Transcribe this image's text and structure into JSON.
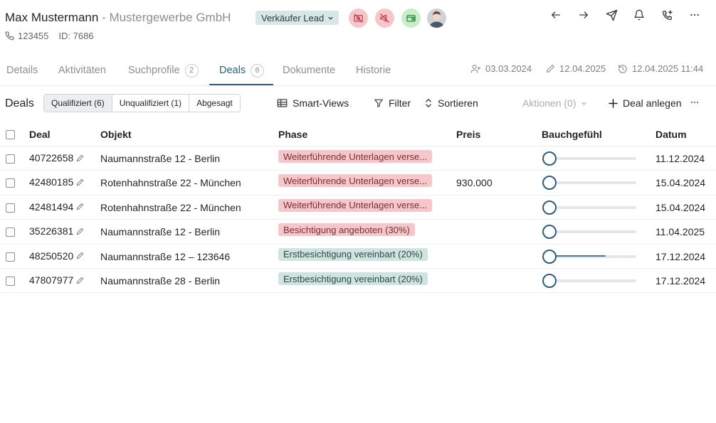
{
  "header": {
    "person_name": "Max Mustermann",
    "separator": " - ",
    "company": "Mustergewerbe GmbH",
    "phone": "123455",
    "id_text": "ID: 7686",
    "lead_badge": "Verkäufer Lead",
    "status_icons": [
      "no-camera-icon",
      "no-megaphone-icon",
      "wallet-icon"
    ],
    "avatar": "user-avatar",
    "top_icons": [
      "arrow-left-icon",
      "arrow-right-icon",
      "send-icon",
      "bell-icon",
      "phone-plus-icon",
      "more-icon"
    ]
  },
  "tabs": [
    {
      "label": "Details"
    },
    {
      "label": "Aktivitäten"
    },
    {
      "label": "Suchprofile",
      "count": "2"
    },
    {
      "label": "Deals",
      "count": "6",
      "active": true
    },
    {
      "label": "Dokumente"
    },
    {
      "label": "Historie"
    }
  ],
  "meta": {
    "created": "03.03.2024",
    "edited": "12.04.2025",
    "history": "12.04.2025 11:44"
  },
  "toolbar": {
    "title": "Deals",
    "filters": [
      "Qualifiziert (6)",
      "Unqualifiziert (1)",
      "Abgesagt"
    ],
    "smart_views": "Smart-Views",
    "filter": "Filter",
    "sort": "Sortieren",
    "actions": "Aktionen (0)",
    "add_deal": "Deal anlegen"
  },
  "table": {
    "columns": [
      "Deal",
      "Objekt",
      "Phase",
      "Preis",
      "Bauchgefühl",
      "Datum"
    ],
    "rows": [
      {
        "deal": "40722658",
        "objekt": "Naumannstraße 12 - Berlin",
        "phase": "Weiterführende Unterlagen verse...",
        "phase_color": "red",
        "preis": "",
        "gefuehl": 0,
        "datum": "11.12.2024"
      },
      {
        "deal": "42480185",
        "objekt": "Rotenhahnstraße 22 - München",
        "phase": "Weiterführende Unterlagen verse...",
        "phase_color": "red",
        "preis": "930.000",
        "gefuehl": 0,
        "datum": "15.04.2024"
      },
      {
        "deal": "42481494",
        "objekt": "Rotenhahnstraße 22 - München",
        "phase": "Weiterführende Unterlagen verse...",
        "phase_color": "red",
        "preis": "",
        "gefuehl": 0,
        "datum": "15.04.2024"
      },
      {
        "deal": "35226381",
        "objekt": "Naumannstraße 12 - Berlin",
        "phase": "Besichtigung angeboten (30%)",
        "phase_color": "red",
        "preis": "",
        "gefuehl": 0,
        "datum": "11.04.2025"
      },
      {
        "deal": "48250520",
        "objekt": "Naumannstraße 12 – 123646",
        "phase": "Erstbesichtigung vereinbart (20%)",
        "phase_color": "green",
        "preis": "",
        "gefuehl": 0.65,
        "datum": "17.12.2024"
      },
      {
        "deal": "47807977",
        "objekt": "Naumannstraße 28 - Berlin",
        "phase": "Erstbesichtigung vereinbart (20%)",
        "phase_color": "green",
        "preis": "",
        "gefuehl": 0,
        "datum": "17.12.2024"
      }
    ]
  },
  "colors": {
    "accent": "#2f5d7c",
    "phase_red": "#f5c6ca",
    "phase_green": "#cfe3df",
    "badge": "#d9e6e6"
  }
}
